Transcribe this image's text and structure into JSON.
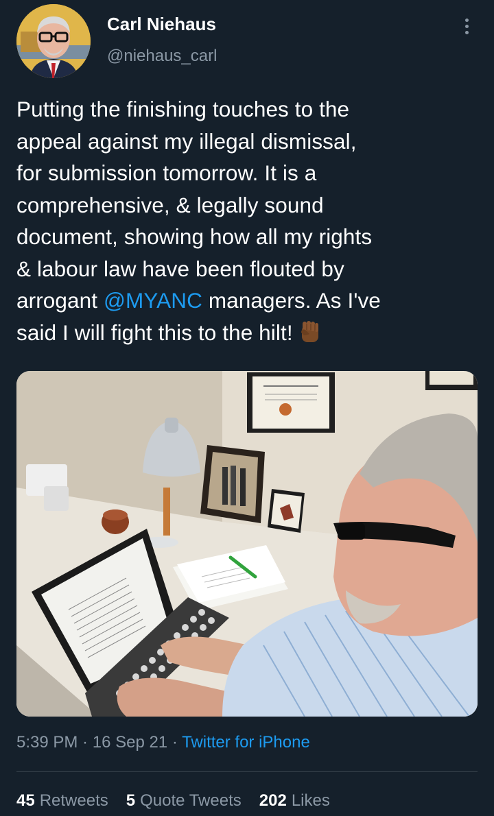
{
  "author": {
    "name": "Carl Niehaus",
    "handle": "@niehaus_carl"
  },
  "tweet": {
    "text_before_mention": "Putting the finishing touches to the\nappeal against my illegal dismissal,\nfor submission tomorrow. It is a\ncomprehensive, & legally sound\ndocument, showing how all my rights\n& labour law have been flouted by\narrogant ",
    "mention": "@MYANC",
    "text_after_mention": " managers. As I've\nsaid I will fight this to the hilt!",
    "emoji": "raised-fist-medium-dark-skin"
  },
  "media": {
    "description_icon": "photo"
  },
  "meta": {
    "time": "5:39 PM",
    "separator": " · ",
    "date": "16 Sep 21",
    "source": "Twitter for iPhone"
  },
  "stats": {
    "retweets_count": "45",
    "retweets_label": "Retweets",
    "quotes_count": "5",
    "quotes_label": "Quote Tweets",
    "likes_count": "202",
    "likes_label": "Likes"
  },
  "colors": {
    "background": "#15202b",
    "primary_text": "#ffffff",
    "secondary_text": "#8b98a5",
    "link": "#1d9bf0",
    "divider": "#38444d"
  }
}
